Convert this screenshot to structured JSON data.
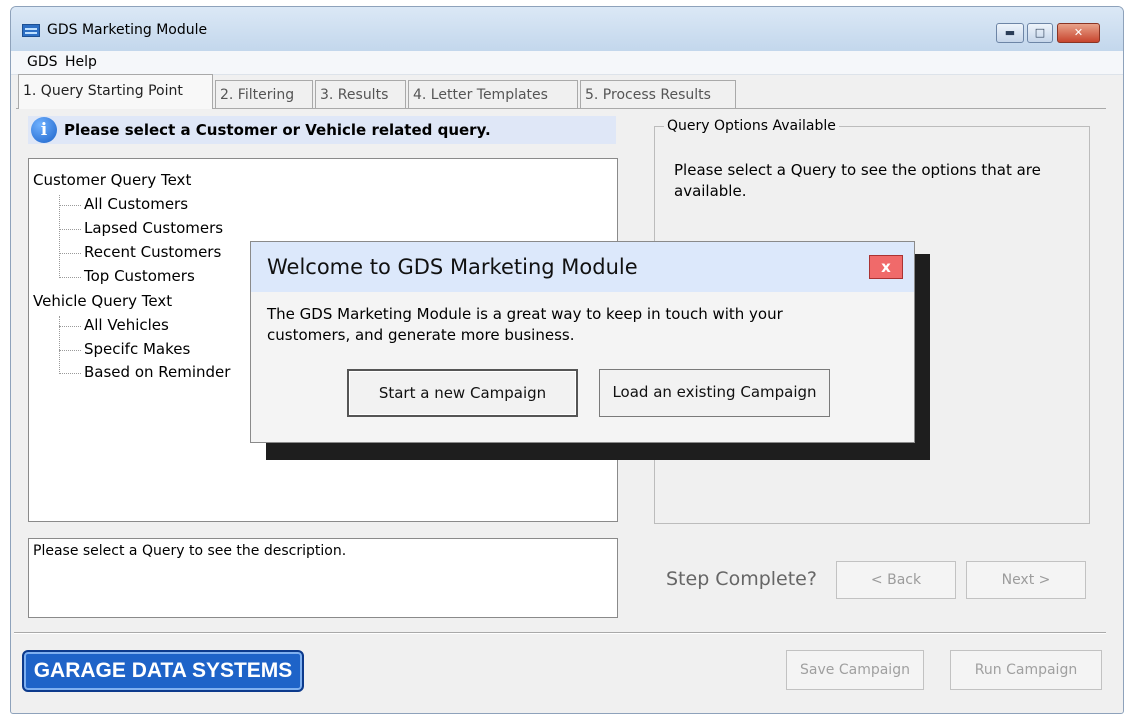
{
  "window": {
    "title": "GDS Marketing Module",
    "min_glyph": "▬",
    "max_glyph": "□",
    "close_glyph": "✕"
  },
  "menu": {
    "items": [
      "GDS",
      "Help"
    ]
  },
  "tabs": [
    {
      "label": "1. Query Starting Point",
      "active": true
    },
    {
      "label": "2. Filtering",
      "active": false
    },
    {
      "label": "3. Results",
      "active": false
    },
    {
      "label": "4. Letter Templates",
      "active": false
    },
    {
      "label": "5. Process Results",
      "active": false
    }
  ],
  "query_panel": {
    "prompt": "Please select a Customer or Vehicle related query.",
    "info_glyph": "i",
    "tree": [
      {
        "label": "Customer Query Text",
        "children": [
          "All Customers",
          "Lapsed Customers",
          "Recent Customers",
          "Top Customers"
        ]
      },
      {
        "label": "Vehicle Query Text",
        "children": [
          "All Vehicles",
          "Specifc Makes",
          "Based on Reminder"
        ]
      }
    ],
    "description": "Please select a Query to see the description."
  },
  "options": {
    "title": "Query Options Available",
    "text": "Please select a Query to see the options that are available."
  },
  "step": {
    "label": "Step Complete?",
    "back_label": "< Back",
    "next_label": "Next >"
  },
  "footer": {
    "logo_text": "GARAGE DATA SYSTEMS",
    "save_label": "Save Campaign",
    "run_label": "Run Campaign"
  },
  "dialog": {
    "title": "Welcome to GDS Marketing Module",
    "close_label": "x",
    "message": "The GDS Marketing Module is a great way to keep in touch with your customers, and generate more business.",
    "start_label": "Start a new Campaign",
    "load_label": "Load an existing Campaign"
  },
  "colors": {
    "dialog_header": "#dce8fb",
    "prompt_bar": "#dfe7f7",
    "logo_blue": "#1e63c8",
    "close_red": "#f06a6a"
  }
}
